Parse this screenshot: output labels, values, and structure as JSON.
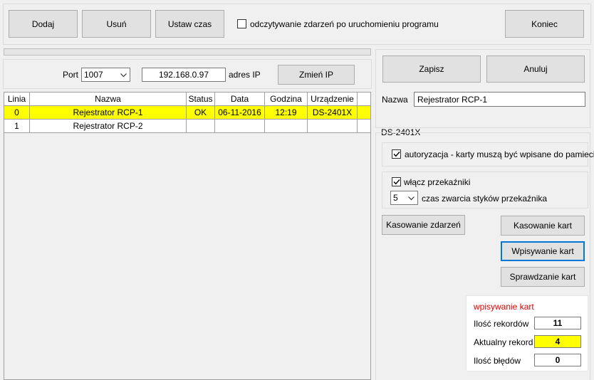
{
  "toolbar": {
    "add_label": "Dodaj",
    "delete_label": "Usuń",
    "set_time_label": "Ustaw czas",
    "read_events_label": "odczytywanie zdarzeń po uruchomieniu programu",
    "read_events_checked": false,
    "end_label": "Koniec"
  },
  "network": {
    "port_label": "Port",
    "port_value": "1007",
    "ip_value": "192.168.0.97",
    "ip_label": "adres IP",
    "change_ip_label": "Zmień IP"
  },
  "device_table": {
    "columns": [
      "Linia",
      "Nazwa",
      "Status",
      "Data",
      "Godzina",
      "Urządzenie"
    ],
    "rows": [
      {
        "linia": "0",
        "nazwa": "Rejestrator RCP-1",
        "status": "OK",
        "data": "06-11-2016",
        "godzina": "12:19",
        "urzadzenie": "DS-2401X",
        "selected": true
      },
      {
        "linia": "1",
        "nazwa": "Rejestrator RCP-2",
        "status": "",
        "data": "",
        "godzina": "",
        "urzadzenie": "",
        "selected": false
      }
    ]
  },
  "editor": {
    "save_label": "Zapisz",
    "cancel_label": "Anuluj",
    "name_label": "Nazwa",
    "name_value": "Rejestrator RCP-1"
  },
  "device_settings": {
    "group_title": "DS-2401X",
    "authorization_label": "autoryzacja - karty muszą być wpisane do pamieci",
    "authorization_checked": true,
    "relays_label": "włącz przekaźniki",
    "relays_checked": true,
    "contact_time_value": "5",
    "contact_time_label": "czas zwarcia styków przekaźnika"
  },
  "actions": {
    "delete_events_label": "Kasowanie zdarzeń",
    "delete_cards_label": "Kasowanie kart",
    "write_cards_label": "Wpisywanie kart",
    "check_cards_label": "Sprawdzanie kart"
  },
  "write_status": {
    "title": "wpisywanie kart",
    "title_color": "#e00000",
    "records_label": "Ilość rekordów",
    "records_value": "11",
    "current_label": "Aktualny rekord",
    "current_value": "4",
    "current_highlight": "#ffff00",
    "errors_label": "Ilość błędów",
    "errors_value": "0"
  }
}
